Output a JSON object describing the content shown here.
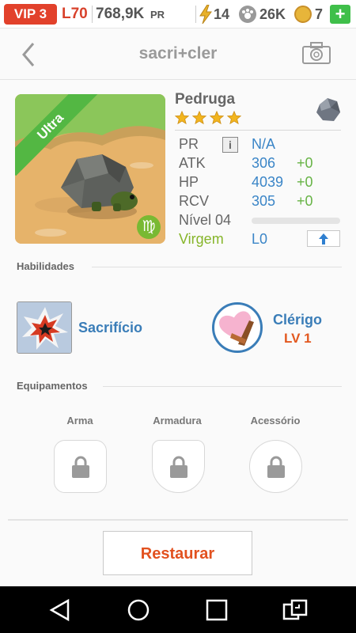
{
  "status": {
    "vip": "VIP 3",
    "level": "L70",
    "pr_value": "768,9K",
    "pr_label": "PR",
    "energy": "14",
    "paws": "26K",
    "coins": "7",
    "add": "+"
  },
  "header": {
    "title": "sacri+cler"
  },
  "pet": {
    "rarity": "Ultra",
    "name": "Pedruga",
    "stars": 4,
    "zodiac_symbol": "♍",
    "stats": {
      "pr": {
        "label": "PR",
        "value": "N/A"
      },
      "atk": {
        "label": "ATK",
        "value": "306",
        "bonus": "+0"
      },
      "hp": {
        "label": "HP",
        "value": "4039",
        "bonus": "+0"
      },
      "rcv": {
        "label": "RCV",
        "value": "305",
        "bonus": "+0"
      },
      "level": {
        "label": "Nível 04",
        "progress": 0
      },
      "sign": {
        "label": "Virgem",
        "value": "L0"
      }
    }
  },
  "abilities": {
    "title": "Habilidades",
    "skill": "Sacrifício",
    "class_name": "Clérigo",
    "class_level": "LV 1"
  },
  "equipment": {
    "title": "Equipamentos",
    "slots": [
      "Arma",
      "Armadura",
      "Acessório"
    ]
  },
  "actions": {
    "restore": "Restaurar"
  },
  "colors": {
    "accent_red": "#e2412b",
    "blue": "#3a85c7",
    "green": "#67b346",
    "orange": "#e2511f"
  }
}
